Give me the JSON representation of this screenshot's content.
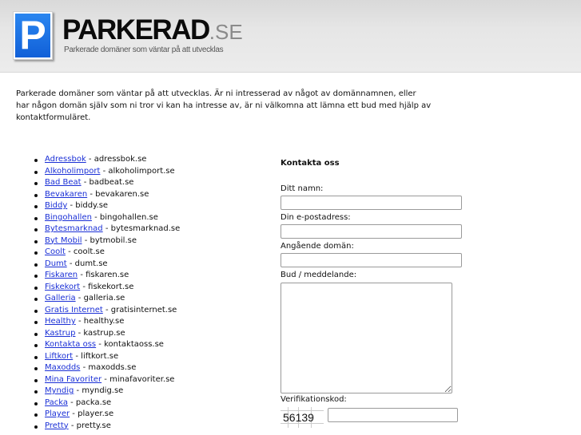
{
  "header": {
    "logo_letter": "P",
    "brand": "PARKERAD",
    "tld": ".SE",
    "tagline": "Parkerade domäner som väntar på att utvecklas"
  },
  "intro": "Parkerade domäner som väntar på att utvecklas. Är ni intresserad av något av domännamnen, eller har någon domän själv som ni tror vi kan ha intresse av, är ni välkomna att lämna ett bud med hjälp av kontaktformuläret.",
  "domains": [
    {
      "name": "Adressbok",
      "domain": " - adressbok.se"
    },
    {
      "name": "Alkoholimport",
      "domain": " - alkoholimport.se"
    },
    {
      "name": "Bad Beat",
      "domain": " - badbeat.se"
    },
    {
      "name": "Bevakaren",
      "domain": " - bevakaren.se"
    },
    {
      "name": "Biddy",
      "domain": " - biddy.se"
    },
    {
      "name": "Bingohallen",
      "domain": " - bingohallen.se"
    },
    {
      "name": "Bytesmarknad",
      "domain": " - bytesmarknad.se"
    },
    {
      "name": "Byt Mobil",
      "domain": " - bytmobil.se"
    },
    {
      "name": "Coolt",
      "domain": " - coolt.se"
    },
    {
      "name": "Dumt",
      "domain": " - dumt.se"
    },
    {
      "name": "Fiskaren",
      "domain": " - fiskaren.se"
    },
    {
      "name": "Fiskekort",
      "domain": " - fiskekort.se"
    },
    {
      "name": "Galleria",
      "domain": " - galleria.se"
    },
    {
      "name": "Gratis Internet",
      "domain": " - gratisinternet.se"
    },
    {
      "name": "Healthy",
      "domain": " - healthy.se"
    },
    {
      "name": "Kastrup",
      "domain": " - kastrup.se"
    },
    {
      "name": "Kontakta oss",
      "domain": " - kontaktaoss.se"
    },
    {
      "name": "Liftkort",
      "domain": " - liftkort.se"
    },
    {
      "name": "Maxodds",
      "domain": " - maxodds.se"
    },
    {
      "name": "Mina Favoriter",
      "domain": " - minafavoriter.se"
    },
    {
      "name": "Myndig",
      "domain": " - myndig.se"
    },
    {
      "name": "Packa",
      "domain": " - packa.se"
    },
    {
      "name": "Player",
      "domain": " - player.se"
    },
    {
      "name": "Pretty",
      "domain": " - pretty.se"
    }
  ],
  "form": {
    "title": "Kontakta oss",
    "name_label": "Ditt namn:",
    "name_value": "",
    "email_label": "Din e-postadress:",
    "email_value": "",
    "domain_label": "Angående domän:",
    "domain_value": "",
    "message_label": "Bud / meddelande:",
    "message_value": "",
    "captcha_label": "Verifikationskod:",
    "captcha_code": "56139",
    "captcha_value": ""
  }
}
